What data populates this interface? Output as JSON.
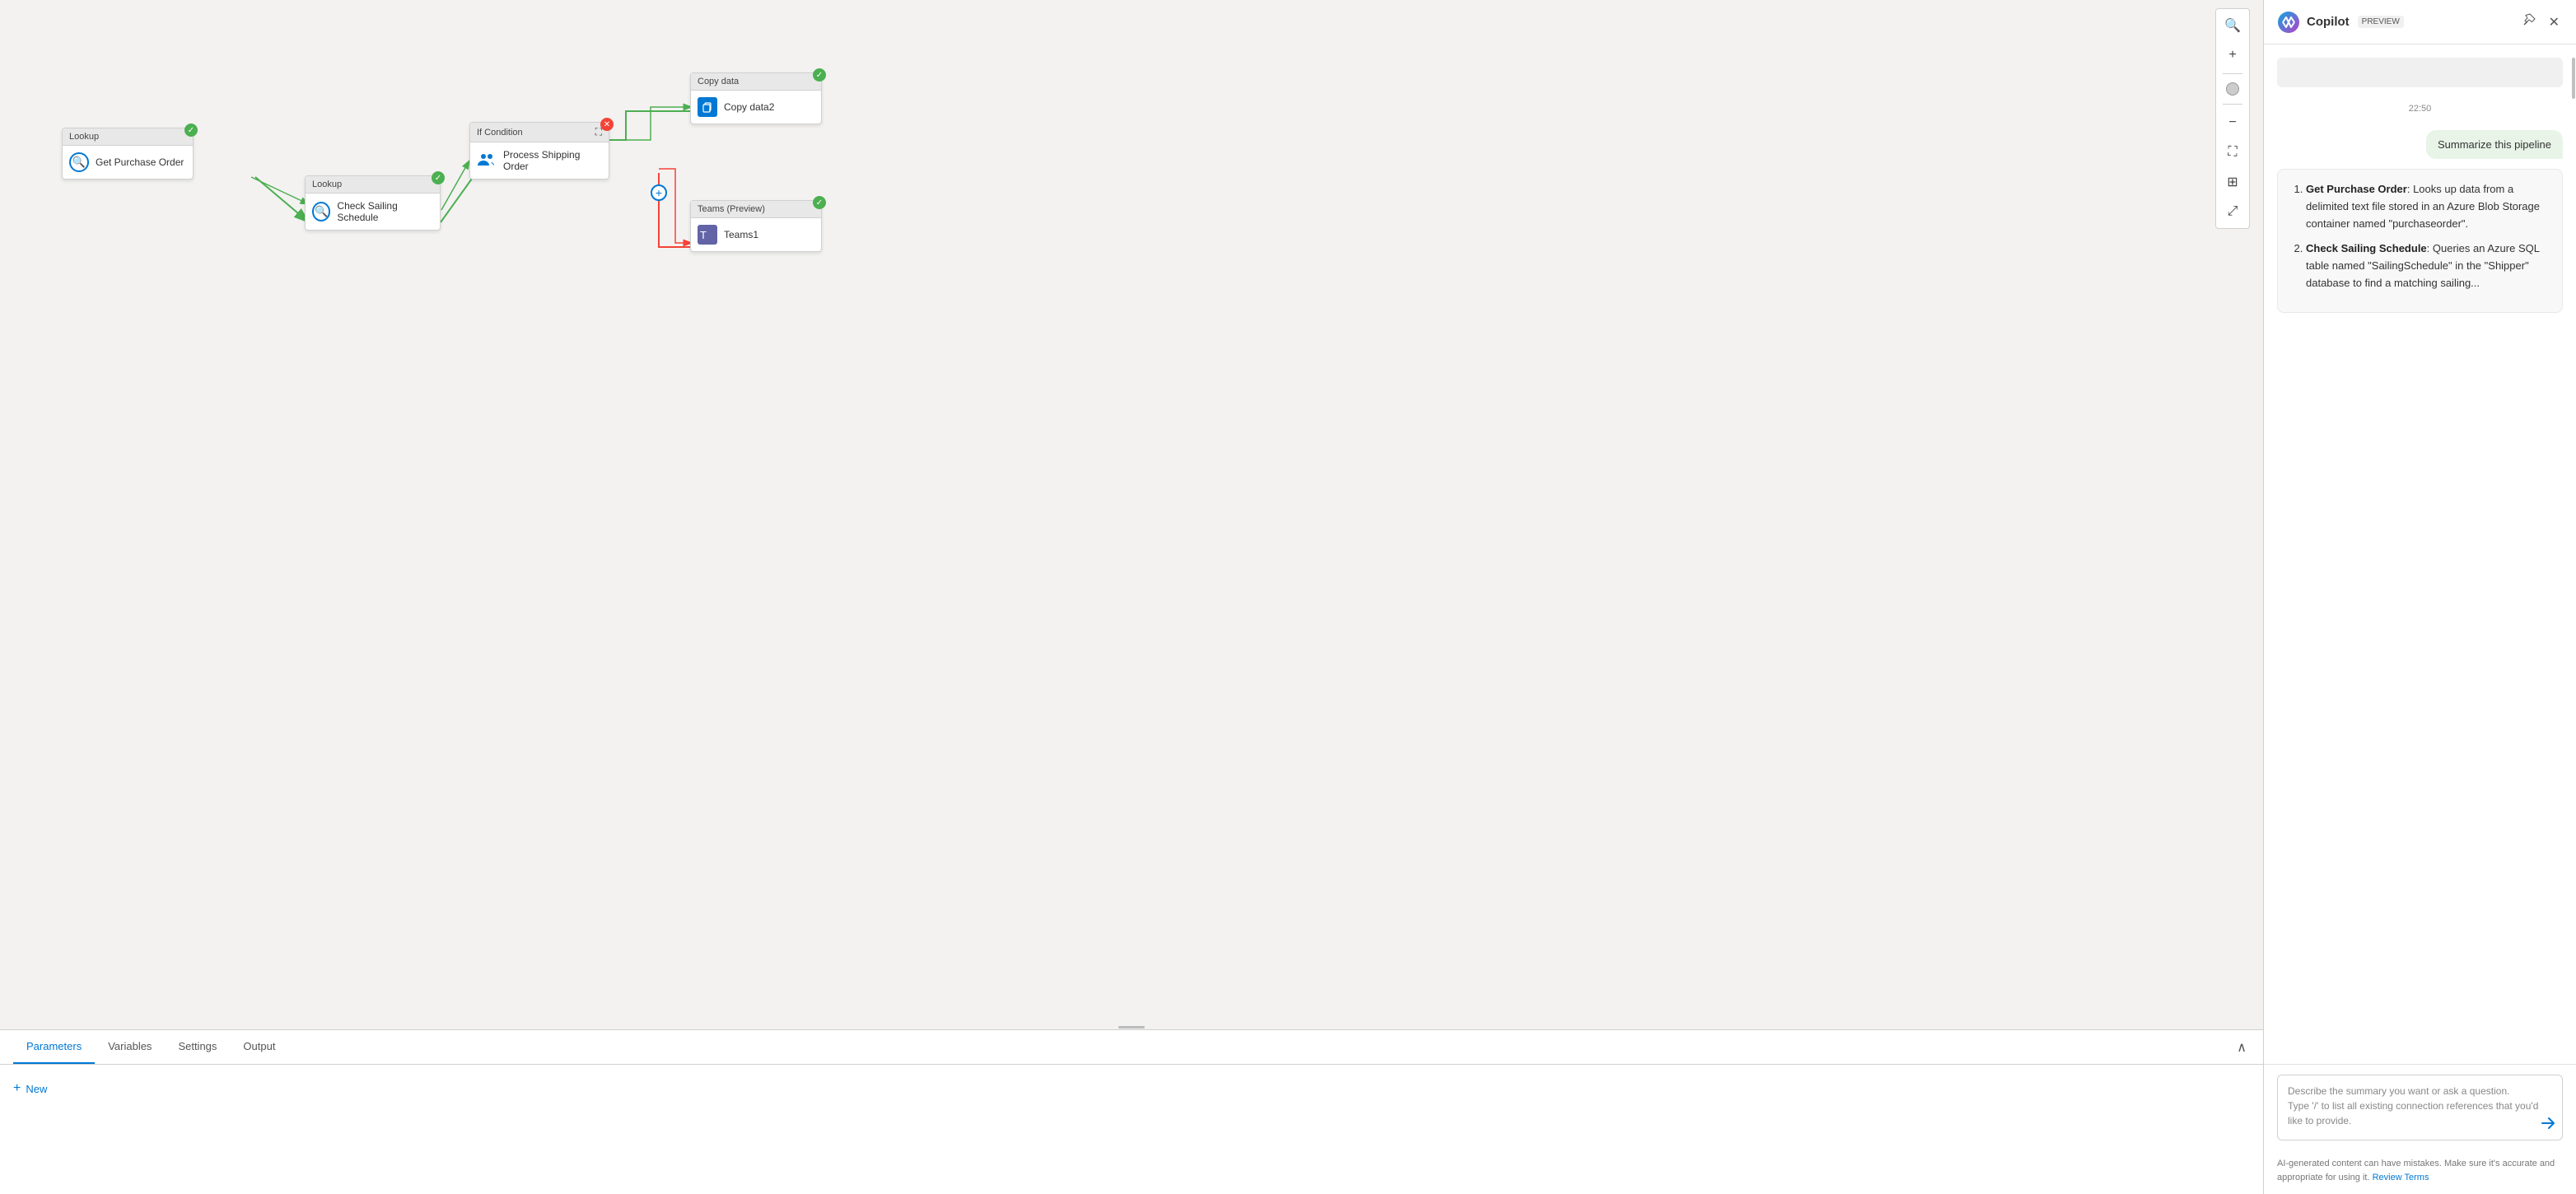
{
  "canvas": {
    "nodes": {
      "get_purchase_order": {
        "header": "Lookup",
        "label": "Get Purchase Order",
        "type": "lookup",
        "has_check": true
      },
      "check_sailing_schedule": {
        "header": "Lookup",
        "label": "Check Sailing Schedule",
        "type": "lookup",
        "has_check": true
      },
      "if_condition": {
        "header": "If Condition",
        "type": "if"
      },
      "process_shipping_order": {
        "label": "Process Shipping Order",
        "type": "process",
        "has_x": true
      },
      "copy_data": {
        "header": "Copy data",
        "label": "Copy data2",
        "type": "copy",
        "has_check": true
      },
      "teams": {
        "header": "Teams (Preview)",
        "label": "Teams1",
        "type": "teams",
        "has_check": true
      }
    }
  },
  "bottom_panel": {
    "tabs": [
      {
        "label": "Parameters",
        "active": true
      },
      {
        "label": "Variables",
        "active": false
      },
      {
        "label": "Settings",
        "active": false
      },
      {
        "label": "Output",
        "active": false
      }
    ],
    "new_button": "New"
  },
  "copilot": {
    "title": "Copilot",
    "preview_badge": "PREVIEW",
    "timestamp": "22:50",
    "user_message": "Summarize this pipeline",
    "ai_response": {
      "items": [
        {
          "name": "Get Purchase Order",
          "description": "Looks up data from a delimited text file stored in an Azure Blob Storage container named \"purchaseorder\"."
        },
        {
          "name": "Check Sailing Schedule",
          "description": "Queries an Azure SQL table named \"SailingSchedule\" in the \"Shipper\" database to find a matching sailing..."
        }
      ]
    },
    "input_placeholder_line1": "Describe the summary you want or ask a question.",
    "input_placeholder_line2": "Type '/' to list all existing connection references that you'd like to provide.",
    "footer_text": "AI-generated content can have mistakes. Make sure it's accurate and appropriate for using it.",
    "footer_link": "Review Terms"
  }
}
